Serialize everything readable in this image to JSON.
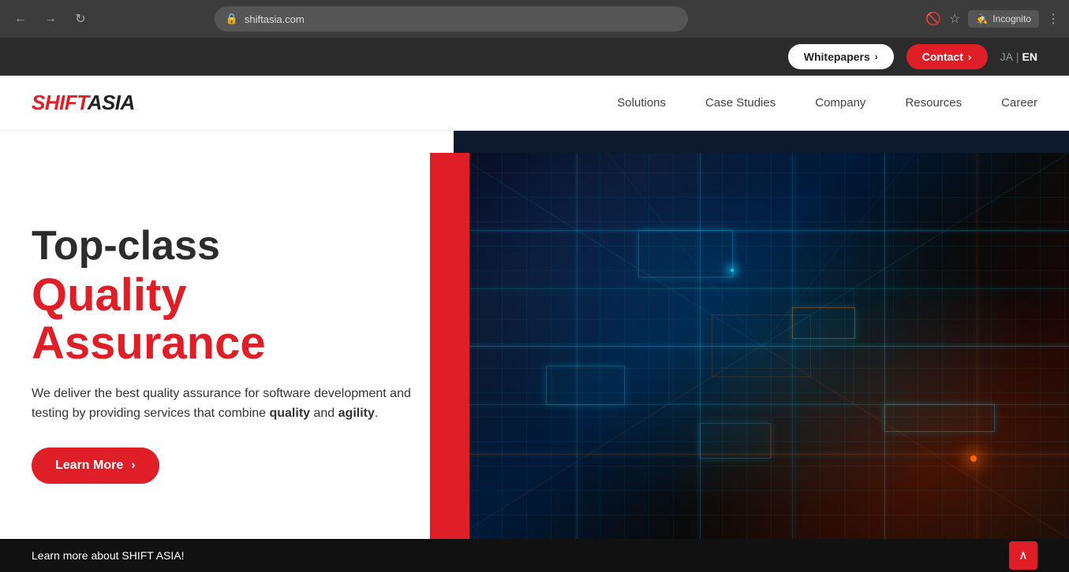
{
  "browser": {
    "back_icon": "←",
    "forward_icon": "→",
    "refresh_icon": "↻",
    "url": "shiftasia.com",
    "lock_icon": "🔒",
    "star_icon": "☆",
    "incognito_icon": "🕵",
    "incognito_label": "Incognito",
    "menu_icon": "⋮"
  },
  "topbar": {
    "whitepapers_label": "Whitepapers",
    "whitepapers_chevron": "›",
    "contact_label": "Contact",
    "contact_chevron": "›",
    "lang_ja": "JA",
    "lang_separator": "|",
    "lang_en": "EN"
  },
  "header": {
    "logo_shift": "SHIFT",
    "logo_asia": "ASIA",
    "nav_items": [
      {
        "label": "Solutions"
      },
      {
        "label": "Case Studies"
      },
      {
        "label": "Company"
      },
      {
        "label": "Resources"
      },
      {
        "label": "Career"
      }
    ]
  },
  "hero": {
    "heading_top": "Top-class",
    "heading_red_line1": "Quality",
    "heading_red_line2": "Assurance",
    "description_start": "We deliver the best quality assurance for software development and testing by providing services that combine ",
    "description_bold1": "quality",
    "description_middle": " and ",
    "description_bold2": "agility",
    "description_end": ".",
    "learn_more_label": "Learn More",
    "learn_more_chevron": "›"
  },
  "bottom_bar": {
    "learn_more_text": "Learn more about SHIFT ASIA!",
    "scroll_up_icon": "∧"
  }
}
